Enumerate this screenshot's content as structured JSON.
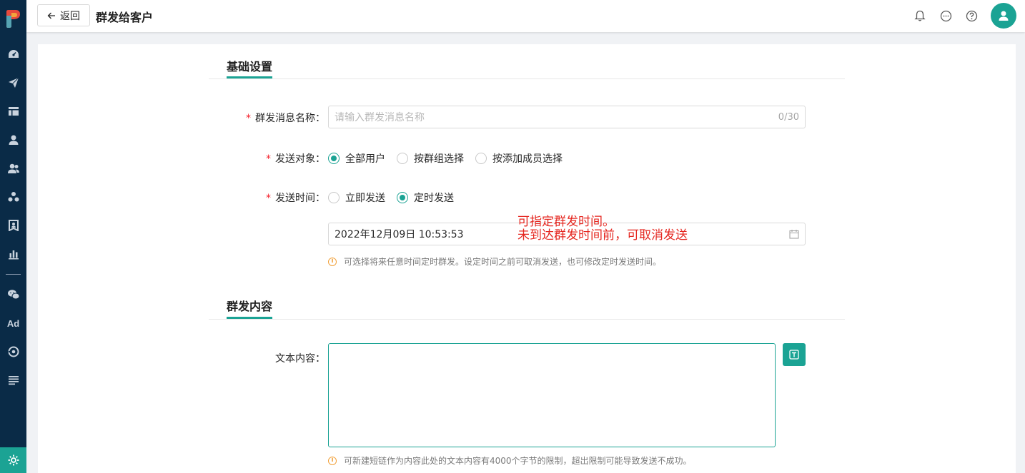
{
  "header": {
    "back_label": "返回",
    "title": "群发给客户",
    "icons": [
      "bell-icon",
      "chat-icon",
      "help-icon",
      "user-avatar-icon"
    ]
  },
  "sidebar": {
    "icons": [
      "dashboard-icon",
      "send-icon",
      "layout-icon",
      "user-icon",
      "users-icon",
      "cluster-icon",
      "bookmark-user-icon",
      "bar-chart-icon",
      "wechat-icon",
      "ad-icon",
      "disc-icon",
      "list-icon",
      "settings-icon"
    ],
    "ad_label": "Ad"
  },
  "sections": {
    "basic": "基础设置",
    "content": "群发内容"
  },
  "form": {
    "name_label": "群发消息名称：",
    "name_placeholder": "请输入群发消息名称",
    "name_counter": "0/30",
    "target_label": "发送对象：",
    "target_options": [
      "全部用户",
      "按群组选择",
      "按添加成员选择"
    ],
    "target_selected": "全部用户",
    "time_label": "发送时间：",
    "time_options": [
      "立即发送",
      "定时发送"
    ],
    "time_selected": "定时发送",
    "datetime_value": "2022年12月09日 10:53:53",
    "time_hint": "可选择将来任意时间定时群发。设定时间之前可取消发送，也可修改定时发送时间。",
    "text_label": "文本内容：",
    "text_value": "",
    "text_hint": "可新建短链作为内容此处的文本内容有4000个字节的限制，超出限制可能导致发送不成功。"
  },
  "annotation": {
    "line1": "可指定群发时间。",
    "line2": "未到达群发时间前，可取消发送"
  },
  "colors": {
    "accent": "#1ba394",
    "sidebar": "#0a2b47",
    "required": "#f5222d",
    "annotation": "#e5261f",
    "warning": "#f2a23c"
  }
}
